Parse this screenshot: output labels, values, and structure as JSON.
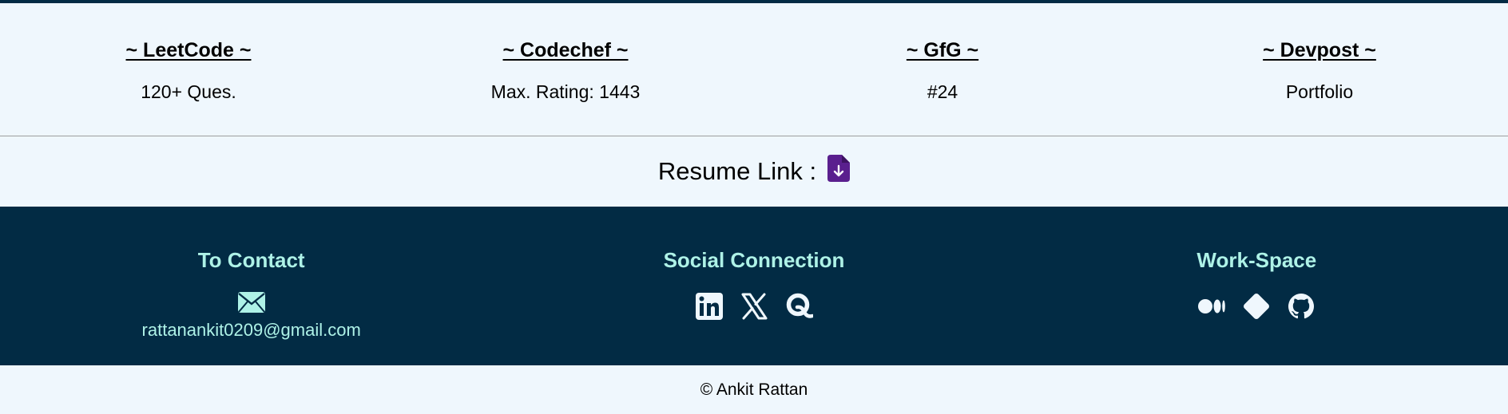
{
  "profiles": [
    {
      "title": "~ LeetCode ~",
      "value": "120+ Ques."
    },
    {
      "title": "~ Codechef ~",
      "value": "Max. Rating: 1443"
    },
    {
      "title": "~ GfG ~",
      "value": "#24"
    },
    {
      "title": "~ Devpost ~",
      "value": "Portfolio"
    }
  ],
  "resume": {
    "label": "Resume Link :",
    "icon": "file-download-icon"
  },
  "footer": {
    "contact": {
      "heading": "To Contact",
      "email": "rattanankit0209@gmail.com",
      "icon": "envelope-icon"
    },
    "social": {
      "heading": "Social Connection",
      "icons": [
        "linkedin-icon",
        "x-twitter-icon",
        "quora-icon"
      ]
    },
    "workspace": {
      "heading": "Work-Space",
      "icons": [
        "medium-icon",
        "git-icon",
        "github-icon"
      ]
    }
  },
  "copyright": "© Ankit Rattan",
  "colors": {
    "background": "#eff7fd",
    "footer_bg": "#022b44",
    "footer_text": "#aef2e7",
    "resume_icon": "#5a1f8e"
  }
}
